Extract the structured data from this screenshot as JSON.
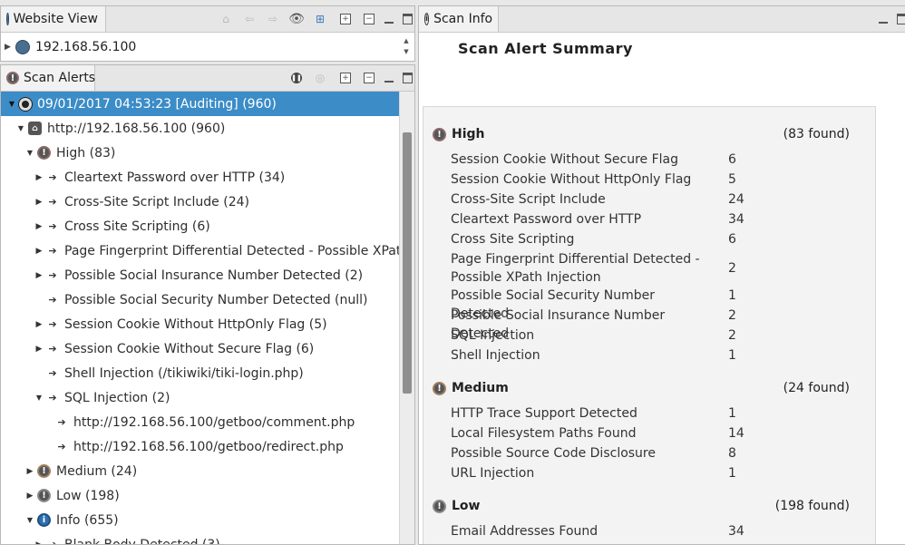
{
  "website_view": {
    "tab_label": "Website View",
    "url": "192.168.56.100"
  },
  "scan_alerts": {
    "tab_label": "Scan Alerts",
    "tree": [
      {
        "label": "09/01/2017 04:53:23 [Auditing]  (960)",
        "icon": "scan-icon",
        "twisty": "expanded"
      },
      {
        "label": "http://192.168.56.100 (960)",
        "icon": "host-icon",
        "twisty": "expanded"
      },
      {
        "label": "High (83)",
        "icon": "high-severity-icon",
        "twisty": "expanded"
      },
      {
        "label": "Cleartext Password over HTTP (34)",
        "icon": "alert-arrow-icon",
        "twisty": "collapsed"
      },
      {
        "label": "Cross-Site Script Include  (24)",
        "icon": "alert-arrow-icon",
        "twisty": "collapsed"
      },
      {
        "label": "Cross Site Scripting (6)",
        "icon": "alert-arrow-icon",
        "twisty": "collapsed"
      },
      {
        "label": "Page Fingerprint Differential Detected - Possible XPath Inje",
        "icon": "alert-arrow-icon",
        "twisty": "collapsed"
      },
      {
        "label": "Possible Social Insurance Number Detected (2)",
        "icon": "alert-arrow-icon",
        "twisty": "collapsed"
      },
      {
        "label": "Possible Social Security Number Detected (null)",
        "icon": "alert-arrow-icon",
        "twisty": "none"
      },
      {
        "label": "Session Cookie Without HttpOnly Flag  (5)",
        "icon": "alert-arrow-icon",
        "twisty": "collapsed"
      },
      {
        "label": "Session Cookie Without Secure Flag  (6)",
        "icon": "alert-arrow-icon",
        "twisty": "collapsed"
      },
      {
        "label": "Shell Injection (/tikiwiki/tiki-login.php)",
        "icon": "alert-arrow-icon",
        "twisty": "none"
      },
      {
        "label": "SQL Injection (2)",
        "icon": "alert-arrow-icon",
        "twisty": "expanded"
      },
      {
        "label": "http://192.168.56.100/getboo/comment.php",
        "icon": "alert-arrow-icon",
        "twisty": "none"
      },
      {
        "label": "http://192.168.56.100/getboo/redirect.php",
        "icon": "alert-arrow-icon",
        "twisty": "none"
      },
      {
        "label": "Medium (24)",
        "icon": "medium-severity-icon",
        "twisty": "collapsed"
      },
      {
        "label": "Low (198)",
        "icon": "low-severity-icon",
        "twisty": "collapsed"
      },
      {
        "label": "Info (655)",
        "icon": "info-severity-icon",
        "twisty": "expanded"
      },
      {
        "label": "Blank Body Detected (3)",
        "icon": "alert-arrow-icon",
        "twisty": "collapsed"
      }
    ]
  },
  "scan_info": {
    "tab_label": "Scan Info",
    "title": "Scan Alert Summary",
    "sections": [
      {
        "name": "High",
        "found": "(83 found)",
        "alerts": [
          {
            "name": "Session Cookie Without Secure Flag",
            "count": "6"
          },
          {
            "name": "Session Cookie Without HttpOnly Flag",
            "count": "5"
          },
          {
            "name": "Cross-Site Script Include",
            "count": "24"
          },
          {
            "name": "Cleartext Password over HTTP",
            "count": "34"
          },
          {
            "name": "Cross Site Scripting",
            "count": "6"
          },
          {
            "name": "Page Fingerprint Differential Detected - Possible XPath Injection",
            "count": "2"
          },
          {
            "name": "Possible Social Security Number Detected",
            "count": "1"
          },
          {
            "name": "Possible Social Insurance Number Detected",
            "count": "2"
          },
          {
            "name": "SQL Injection",
            "count": "2"
          },
          {
            "name": "Shell Injection",
            "count": "1"
          }
        ]
      },
      {
        "name": "Medium",
        "found": "(24 found)",
        "alerts": [
          {
            "name": "HTTP Trace Support Detected",
            "count": "1"
          },
          {
            "name": "Local Filesystem Paths Found",
            "count": "14"
          },
          {
            "name": "Possible Source Code Disclosure",
            "count": "8"
          },
          {
            "name": "URL Injection",
            "count": "1"
          }
        ]
      },
      {
        "name": "Low",
        "found": "(198 found)",
        "alerts": [
          {
            "name": "Email Addresses Found",
            "count": "34"
          }
        ]
      }
    ]
  }
}
